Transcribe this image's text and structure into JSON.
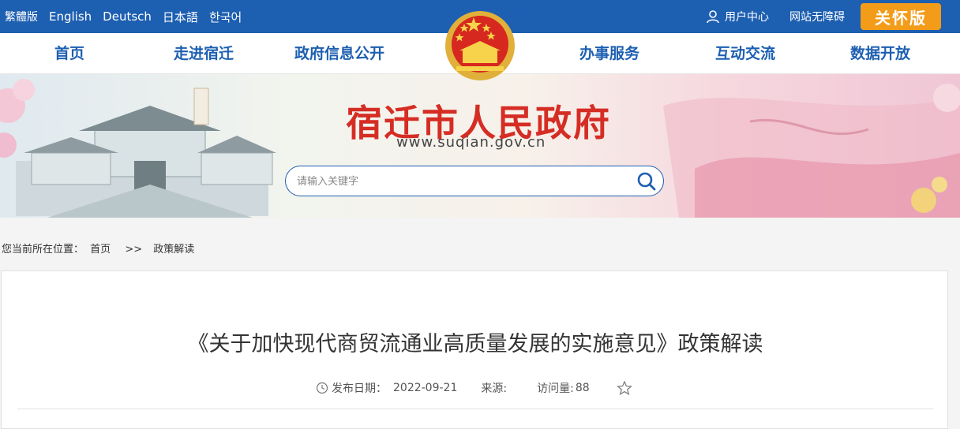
{
  "topbar": {
    "languages": [
      "繁體版",
      "English",
      "Deutsch",
      "日本語",
      "한국어"
    ],
    "user_center": "用户中心",
    "accessibility": "网站无障碍",
    "care_mode": "关怀版",
    "bg_color": "#1d5fb1",
    "care_color": "#f39c1a"
  },
  "nav": {
    "items": [
      "首页",
      "走进宿迁",
      "政府信息公开",
      "办事服务",
      "互动交流",
      "数据开放"
    ],
    "text_color": "#1d5fb1"
  },
  "banner": {
    "title": "宿迁市人民政府",
    "url": "www.suqian.gov.cn",
    "title_color": "#d52d24"
  },
  "search": {
    "placeholder": "请输入关键字"
  },
  "breadcrumb": {
    "label": "您当前所在位置：",
    "home": "首页",
    "separator": ">>",
    "current": "政策解读"
  },
  "article": {
    "title": "《关于加快现代商贸流通业高质量发展的实施意见》政策解读",
    "publish_label": "发布日期：",
    "publish_date": "2022-09-21",
    "source_label": "来源:",
    "visits_label": "访问量:",
    "visits_count": "88"
  },
  "icons": {
    "user": "user-icon",
    "search": "search-icon",
    "clock": "clock-icon",
    "favorite": "star-icon",
    "emblem": "national-emblem-icon"
  }
}
